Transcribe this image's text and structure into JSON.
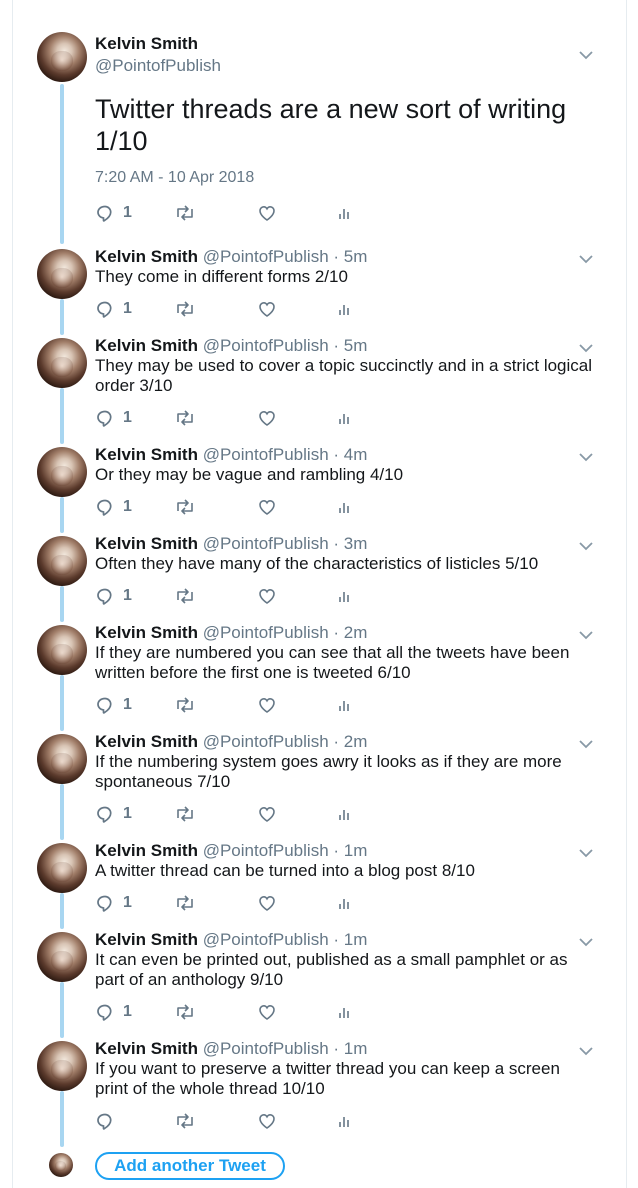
{
  "author": {
    "name": "Kelvin Smith",
    "handle": "@PointofPublish"
  },
  "first_tweet": {
    "text": "Twitter threads are a new sort of writing 1/10",
    "timestamp": "7:20 AM - 10 Apr 2018",
    "reply_count": "1"
  },
  "tweets": [
    {
      "time": "5m",
      "text": "They come in different forms 2/10",
      "reply_count": "1"
    },
    {
      "time": "5m",
      "text": "They may be used to cover a topic succinctly and in a strict logical order 3/10",
      "reply_count": "1"
    },
    {
      "time": "4m",
      "text": "Or they may be vague and rambling 4/10",
      "reply_count": "1"
    },
    {
      "time": "3m",
      "text": "Often they have many of the characteristics of listicles 5/10",
      "reply_count": "1"
    },
    {
      "time": "2m",
      "text": "If they are numbered you can see that all the tweets have been written before the first one is tweeted 6/10",
      "reply_count": "1"
    },
    {
      "time": "2m",
      "text": "If the numbering system goes awry it looks as if they are more spontaneous 7/10",
      "reply_count": "1"
    },
    {
      "time": "1m",
      "text": "A twitter thread can be turned into a blog post 8/10",
      "reply_count": "1"
    },
    {
      "time": "1m",
      "text": "It can even be printed out, published as a small pamphlet or as part of an anthology 9/10",
      "reply_count": "1"
    },
    {
      "time": "1m",
      "text": "If you want to preserve a twitter thread you can keep a screen print of the whole thread 10/10",
      "reply_count": ""
    }
  ],
  "separator": "·",
  "add_tweet_label": "Add another Tweet",
  "icons": {
    "reply": "reply-icon",
    "retweet": "retweet-icon",
    "like": "heart-icon",
    "analytics": "analytics-icon",
    "caret": "chevron-down-icon"
  },
  "colors": {
    "thread_line": "#a8d6f1",
    "accent": "#1da1f2",
    "secondary_text": "#657786",
    "icon": "#657786"
  }
}
